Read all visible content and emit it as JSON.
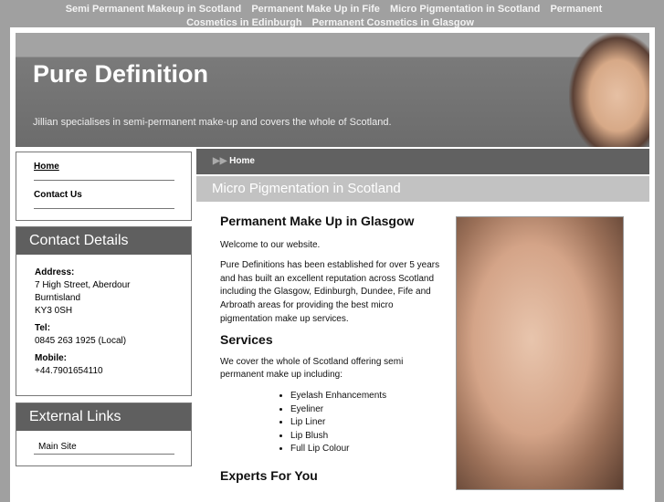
{
  "top_links": [
    "Semi Permanent Makeup in Scotland",
    "Permanent Make Up in Fife",
    "Micro Pigmentation in Scotland",
    "Permanent Cosmetics in Edinburgh",
    "Permanent Cosmetics in Glasgow"
  ],
  "header": {
    "title": "Pure Definition",
    "tagline": "Jillian specialises in semi-permanent make-up and covers the whole of Scotland."
  },
  "nav": [
    "Home",
    "Contact Us"
  ],
  "contact": {
    "heading": "Contact Details",
    "address_label": "Address:",
    "address": [
      "7 High Street, Aberdour",
      "Burntisland",
      "KY3 0SH"
    ],
    "tel_label": "Tel:",
    "tel": "0845 263 1925 (Local)",
    "mobile_label": "Mobile:",
    "mobile": "+44.7901654110"
  },
  "external": {
    "heading": "External Links",
    "links": [
      "Main Site"
    ]
  },
  "breadcrumb": "Home",
  "page_title": "Micro Pigmentation in Scotland",
  "content": {
    "h1": "Permanent Make Up in Glasgow",
    "p1": "Welcome to our website.",
    "p2": "Pure Definitions has been established for over 5 years and has built an excellent reputation across Scotland including the Glasgow, Edinburgh, Dundee, Fife and Arbroath areas for providing the best micro pigmentation make up services.",
    "h2": "Services",
    "p3": "We cover the whole of Scotland offering semi permanent make up including:",
    "services": [
      "Eyelash Enhancements",
      "Eyeliner",
      "Lip Liner",
      "Lip Blush",
      "Full Lip Colour"
    ],
    "h3": "Experts For You"
  }
}
